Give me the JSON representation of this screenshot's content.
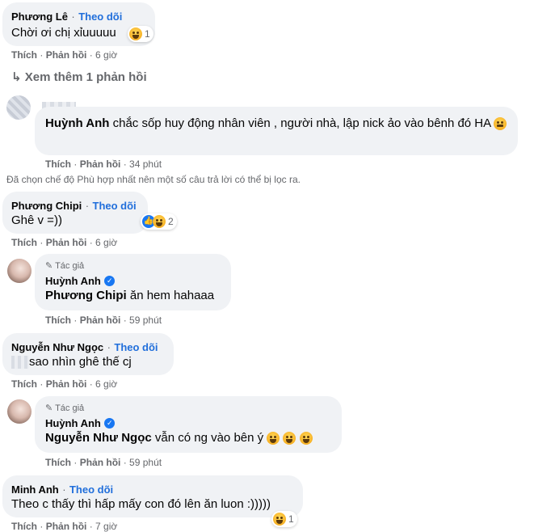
{
  "dot": "·",
  "follow_label": "Theo dõi",
  "like_label": "Thích",
  "reply_label": "Phản hồi",
  "author_label": "Tác giả",
  "comments": {
    "c1": {
      "name": "Phương Lê",
      "text": "Chời ơi chị xỉuuuuu",
      "reaction_count": "1",
      "time": "6 giờ"
    },
    "more_replies": "Xem thêm 1 phản hồi",
    "c2": {
      "name": "Huỳnh Anh",
      "text": "chắc sốp huy động nhân viên , người nhà, lập nick ảo vào bênh đó HA",
      "time": "34 phút"
    },
    "filter_notice": "Đã chọn chế độ Phù hợp nhất nên một số câu trả lời có thể bị lọc ra.",
    "c3": {
      "name": "Phương Chipi",
      "text": "Ghê v =))",
      "reaction_count": "2",
      "time": "6 giờ"
    },
    "r3": {
      "name": "Huỳnh Anh",
      "mention": "Phương Chipi",
      "text": "ăn hem hahaaa",
      "time": "59 phút"
    },
    "c4": {
      "name": "Nguyễn Như Ngọc",
      "text": "sao nhìn ghê thế cj",
      "time": "6 giờ"
    },
    "r4": {
      "name": "Huỳnh Anh",
      "mention": "Nguyễn Như Ngọc",
      "text": "vẫn có ng vào bên ý",
      "time": "59 phút"
    },
    "c5": {
      "name": "Minh Anh",
      "text": "Theo c thấy thì hấp mấy con đó lên ăn luon :)))))",
      "reaction_count": "1",
      "time": "7 giờ"
    }
  },
  "colors": {
    "bubble": "#f0f2f5",
    "link": "#216fdb",
    "muted": "#65676b",
    "accent": "#1877f2"
  }
}
